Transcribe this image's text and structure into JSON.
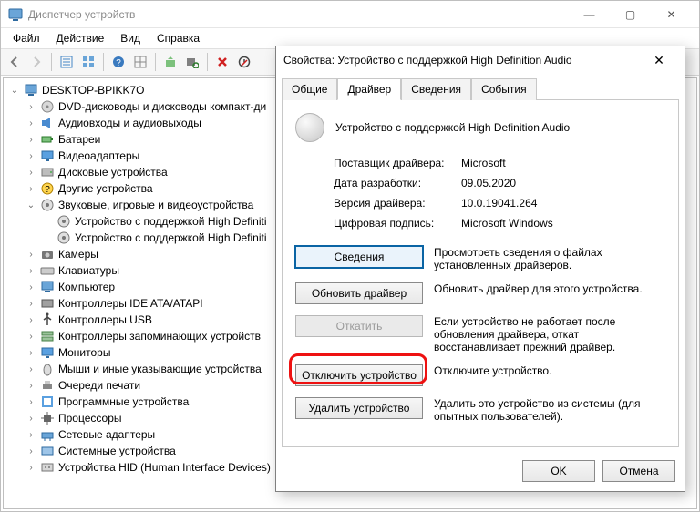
{
  "window": {
    "title": "Диспетчер устройств",
    "win_min": "—",
    "win_max": "▢",
    "win_close": "✕"
  },
  "menu": {
    "file": "Файл",
    "action": "Действие",
    "view": "Вид",
    "help": "Справка"
  },
  "tree": {
    "root": "DESKTOP-BPIKK7O",
    "items": [
      "DVD-дисководы и дисководы компакт-ди",
      "Аудиовходы и аудиовыходы",
      "Батареи",
      "Видеоадаптеры",
      "Дисковые устройства",
      "Другие устройства"
    ],
    "sound_label": "Звуковые, игровые и видеоустройства",
    "sound_children": [
      "Устройство с поддержкой High Definiti",
      "Устройство с поддержкой High Definiti"
    ],
    "items2": [
      "Камеры",
      "Клавиатуры",
      "Компьютер",
      "Контроллеры IDE ATA/ATAPI",
      "Контроллеры USB",
      "Контроллеры запоминающих устройств",
      "Мониторы",
      "Мыши и иные указывающие устройства",
      "Очереди печати",
      "Программные устройства",
      "Процессоры",
      "Сетевые адаптеры",
      "Системные устройства",
      "Устройства HID (Human Interface Devices)"
    ]
  },
  "dialog": {
    "title": "Свойства: Устройство с поддержкой High Definition Audio",
    "tabs": {
      "general": "Общие",
      "driver": "Драйвер",
      "details": "Сведения",
      "events": "События"
    },
    "device_name": "Устройство с поддержкой High Definition Audio",
    "info": {
      "provider_l": "Поставщик драйвера:",
      "provider_v": "Microsoft",
      "date_l": "Дата разработки:",
      "date_v": "09.05.2020",
      "version_l": "Версия драйвера:",
      "version_v": "10.0.19041.264",
      "sign_l": "Цифровая подпись:",
      "sign_v": "Microsoft Windows"
    },
    "buttons": {
      "details": "Сведения",
      "update": "Обновить драйвер",
      "rollback": "Откатить",
      "disable": "Отключить устройство",
      "uninstall": "Удалить устройство",
      "ok": "OK",
      "cancel": "Отмена"
    },
    "desc": {
      "details": "Просмотреть сведения о файлах установленных драйверов.",
      "update": "Обновить драйвер для этого устройства.",
      "rollback": "Если устройство не работает после обновления драйвера, откат восстанавливает прежний драйвер.",
      "disable": "Отключите устройство.",
      "uninstall": "Удалить это устройство из системы (для опытных пользователей)."
    }
  }
}
